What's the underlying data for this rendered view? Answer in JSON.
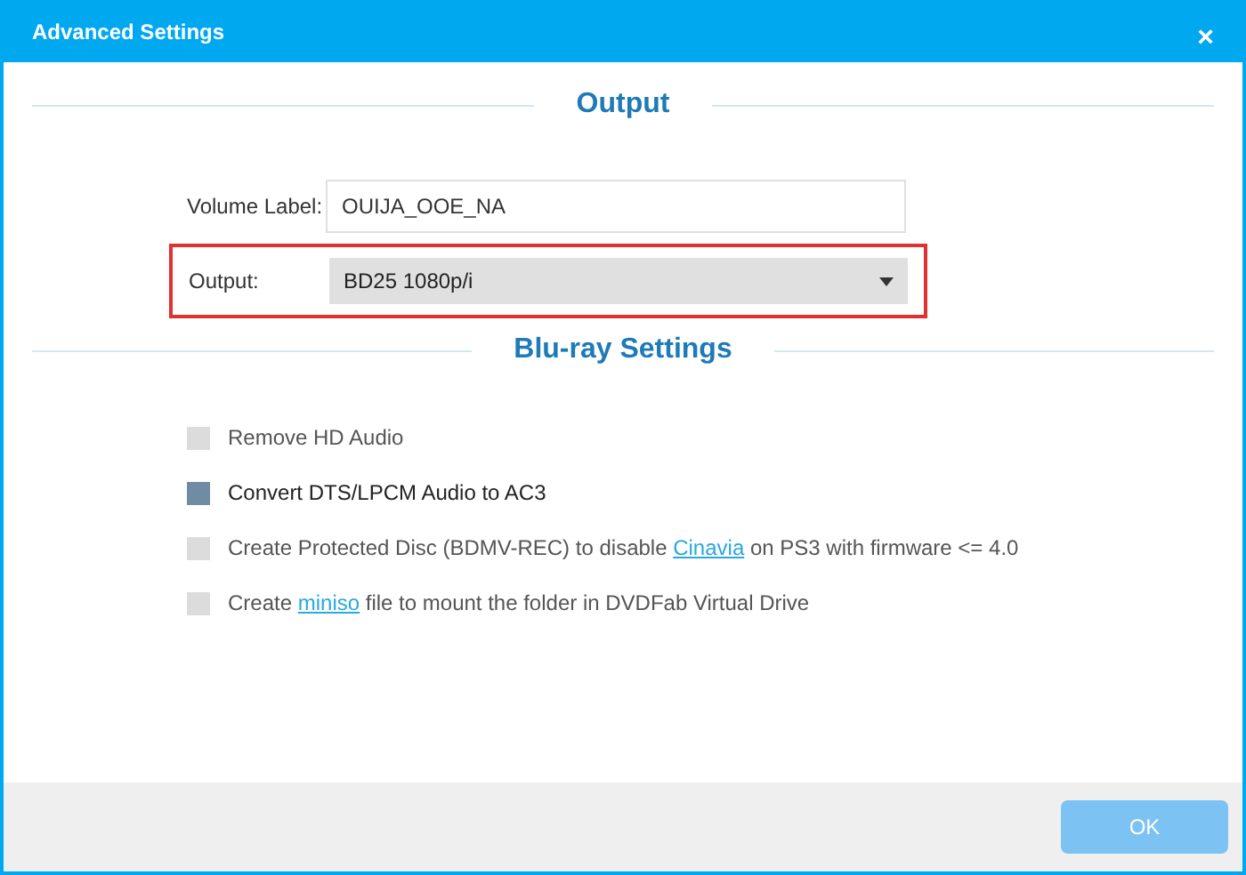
{
  "window": {
    "title": "Advanced Settings",
    "close": "×"
  },
  "output_section": {
    "heading": "Output",
    "volume_label": {
      "label": "Volume Label:",
      "value": "OUIJA_OOE_NA"
    },
    "output": {
      "label": "Output:",
      "value": "BD25 1080p/i",
      "highlighted": true
    }
  },
  "bluray_section": {
    "heading": "Blu-ray Settings",
    "options": [
      {
        "checked": false,
        "segments": [
          {
            "kind": "plain",
            "text": "Remove HD Audio"
          }
        ]
      },
      {
        "checked": true,
        "segments": [
          {
            "kind": "plain",
            "text": "Convert DTS/LPCM Audio to AC3"
          }
        ]
      },
      {
        "checked": false,
        "segments": [
          {
            "kind": "plain",
            "text": "Create Protected Disc (BDMV-REC) to disable "
          },
          {
            "kind": "link",
            "text": "Cinavia"
          },
          {
            "kind": "plain",
            "text": " on PS3 with firmware <= 4.0"
          }
        ]
      },
      {
        "checked": false,
        "segments": [
          {
            "kind": "plain",
            "text": "Create "
          },
          {
            "kind": "link",
            "text": "miniso"
          },
          {
            "kind": "plain",
            "text": " file to mount the folder in DVDFab Virtual Drive"
          }
        ]
      }
    ]
  },
  "buttons": [
    {
      "label": "OK",
      "disabled": true
    }
  ]
}
